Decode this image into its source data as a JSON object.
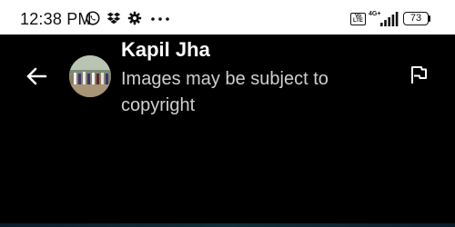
{
  "status_bar": {
    "time": "12:38 PM",
    "icons": [
      "whatsapp-icon",
      "dropbox-icon",
      "gear-icon",
      "more-dots-icon",
      "volte-icon",
      "signal-icon",
      "battery-icon"
    ],
    "volte_label": "Vo LTE",
    "network_label": "4G+",
    "battery_level": "73"
  },
  "header": {
    "title": "Kapil Jha",
    "subtitle": "Images may be subject to copyright",
    "back_icon": "arrow-back-icon",
    "flag_icon": "flag-icon"
  },
  "colors": {
    "background": "#000000",
    "status_bar": "#ffffff",
    "title": "#ffffff",
    "subtitle": "#cfcfcf"
  }
}
